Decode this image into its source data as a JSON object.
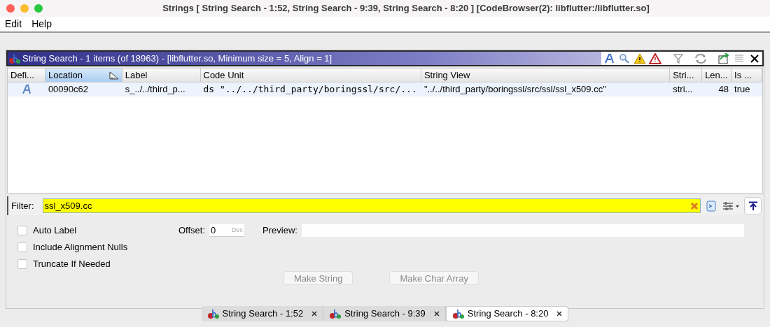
{
  "window": {
    "title": "Strings [ String Search - 1:52, String Search - 9:39, String Search - 8:20 ] [CodeBrowser(2): libflutter:/libflutter.so]"
  },
  "menu": [
    "Edit",
    "Help"
  ],
  "panel": {
    "title": "String Search - 1 items (of 18963) - [libflutter.so, Minimum size = 5, Align = 1]"
  },
  "table": {
    "columns": [
      {
        "label": "Defi...",
        "sorted": false
      },
      {
        "label": "Location",
        "sorted": true
      },
      {
        "label": "Label",
        "sorted": false
      },
      {
        "label": "Code Unit",
        "sorted": false
      },
      {
        "label": "String View",
        "sorted": false
      },
      {
        "label": "Stri...",
        "sorted": false
      },
      {
        "label": "Len...",
        "sorted": false
      },
      {
        "label": "Is ...",
        "sorted": false
      }
    ],
    "rows": [
      {
        "cells": [
          "",
          "00090c62",
          "s_../../third_p...",
          "ds \"../../third_party/boringssl/src/...",
          "\"../../third_party/boringssl/src/ssl/ssl_x509.cc\"",
          "stri...",
          "48",
          "true"
        ],
        "selected": false
      }
    ]
  },
  "filter": {
    "label": "Filter:",
    "value": "ssl_x509.cc"
  },
  "options": [
    {
      "label": "Auto Label",
      "checked": false
    },
    {
      "label": "Include Alignment Nulls",
      "checked": false
    },
    {
      "label": "Truncate If Needed",
      "checked": false
    }
  ],
  "offset": {
    "label": "Offset:",
    "value": "0",
    "unit": "Dec"
  },
  "preview": {
    "label": "Preview:"
  },
  "buttons": [
    {
      "label": "Make String",
      "disabled": true
    },
    {
      "label": "Make Char Array",
      "disabled": true
    }
  ],
  "tabs": [
    {
      "label": "String Search - 1:52",
      "selected": false
    },
    {
      "label": "String Search - 9:39",
      "selected": false
    },
    {
      "label": "String Search - 8:20",
      "selected": true
    }
  ]
}
